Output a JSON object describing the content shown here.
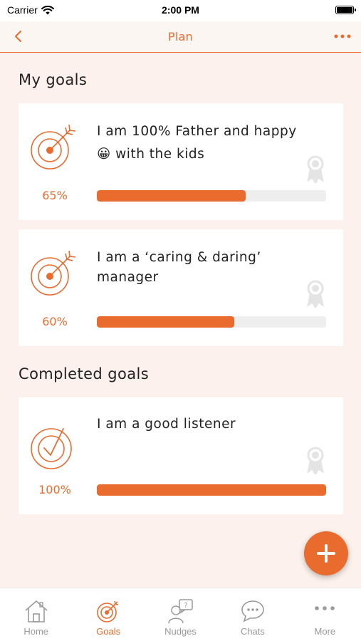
{
  "status_bar": {
    "carrier": "Carrier",
    "time": "2:00 PM"
  },
  "nav": {
    "title": "Plan"
  },
  "my_goals": {
    "title": "My goals",
    "items": [
      {
        "text": "I am 100% Father and happy 😀 with the kids",
        "percent_label": "65%",
        "progress": 0.65
      },
      {
        "text": "I am a ‘caring & daring’ manager",
        "percent_label": "60%",
        "progress": 0.6
      }
    ]
  },
  "completed_goals": {
    "title": "Completed goals",
    "items": [
      {
        "text": "I am a good listener",
        "percent_label": "100%",
        "progress": 1.0
      }
    ]
  },
  "tabs": [
    {
      "label": "Home",
      "icon": "home-icon",
      "active": false
    },
    {
      "label": "Goals",
      "icon": "target-icon",
      "active": true
    },
    {
      "label": "Nudges",
      "icon": "nudges-icon",
      "active": false
    },
    {
      "label": "Chats",
      "icon": "chat-icon",
      "active": false
    },
    {
      "label": "More",
      "icon": "more-icon",
      "active": false
    }
  ],
  "colors": {
    "accent": "#ea6b2e",
    "background": "#fcf1ec",
    "inactive": "#9a9a9a",
    "track": "#eeeeee"
  }
}
